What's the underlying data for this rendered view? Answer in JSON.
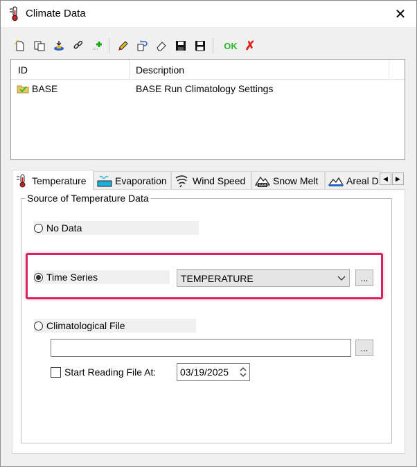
{
  "window": {
    "title": "Climate Data",
    "icon": "thermometer-icon",
    "close": "✕"
  },
  "toolbar": {
    "buttons": [
      {
        "name": "new-icon"
      },
      {
        "name": "copy-icon"
      },
      {
        "name": "import-icon"
      },
      {
        "name": "link-icon"
      },
      {
        "name": "add-icon"
      },
      {
        "name": "edit-icon"
      },
      {
        "name": "undo-icon"
      },
      {
        "name": "erase-icon"
      },
      {
        "name": "save-icon"
      },
      {
        "name": "save-as-icon"
      }
    ],
    "ok_label": "OK",
    "cancel_label": "✗"
  },
  "list": {
    "columns": [
      "ID",
      "Description"
    ],
    "rows": [
      {
        "id": "BASE",
        "description": "BASE Run Climatology Settings",
        "icon": "folder-check-icon"
      }
    ]
  },
  "tabs": [
    {
      "label": "Temperature",
      "icon": "thermometer-icon",
      "active": true
    },
    {
      "label": "Evaporation",
      "icon": "evaporation-icon",
      "active": false
    },
    {
      "label": "Wind Speed",
      "icon": "wind-icon",
      "active": false
    },
    {
      "label": "Snow Melt",
      "icon": "snow-melt-icon",
      "active": false
    },
    {
      "label": "Areal D",
      "icon": "mountain-icon",
      "active": false
    }
  ],
  "temperature": {
    "group_title": "Source of Temperature Data",
    "options": {
      "no_data": "No Data",
      "time_series": "Time Series",
      "climatological_file": "Climatological File"
    },
    "selected": "time_series",
    "time_series_value": "TEMPERATURE",
    "browse_label": "...",
    "file_path": "",
    "start_reading_label": "Start Reading File At:",
    "start_reading_checked": false,
    "start_date": "03/19/2025"
  },
  "colors": {
    "highlight": "#d6245e",
    "ok_green": "#2eb82e",
    "cancel_red": "#e0201b"
  }
}
